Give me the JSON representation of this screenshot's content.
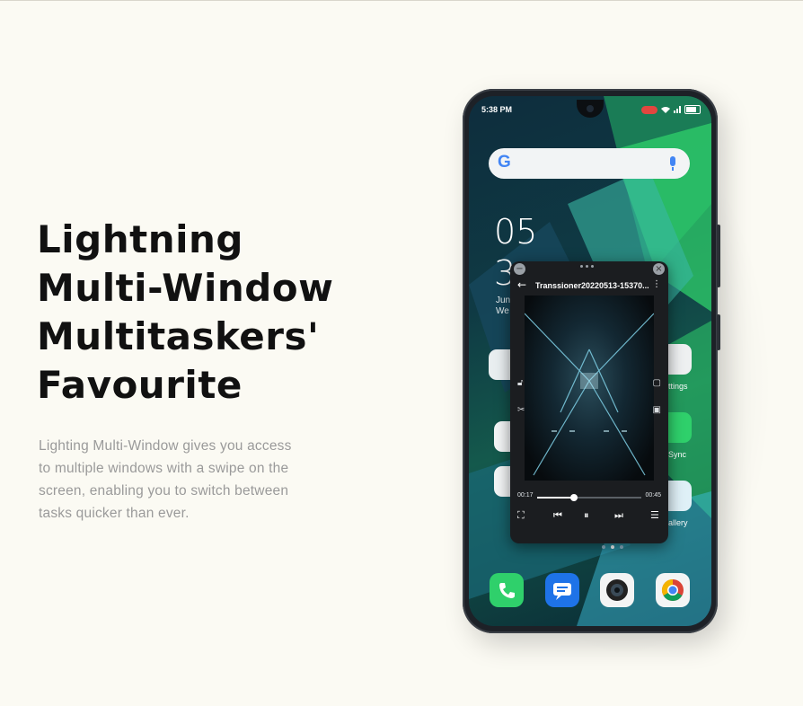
{
  "headline": {
    "lines": [
      "Lightning",
      "Multi-Window",
      "Multitaskers'",
      "Favourite"
    ]
  },
  "description": {
    "lines": [
      "Lighting Multi-Window gives you access",
      "to multiple windows with a swipe on the",
      "screen, enabling you to switch between",
      "tasks quicker than ever."
    ]
  },
  "phone": {
    "status_time": "5:38 PM",
    "search_logo": "G",
    "clock_hour": "05",
    "clock_minute": "3",
    "date_line1": "Jun",
    "date_line2": "We",
    "app_labels": {
      "settings": "ttings",
      "sync": "Sync",
      "gallery": "allery"
    },
    "float_window": {
      "title": "Transsioner20220513-15370...",
      "time_elapsed": "00:17",
      "time_total": "00:45",
      "progress": 0.35
    },
    "dock": [
      "phone-icon",
      "messages-icon",
      "camera-icon",
      "chrome-icon"
    ]
  },
  "colors": {
    "background": "#fbfaf3",
    "headline": "#111111",
    "description": "#9a9a9a",
    "accent_green": "#2fd06b",
    "record_red": "#e2463f"
  }
}
